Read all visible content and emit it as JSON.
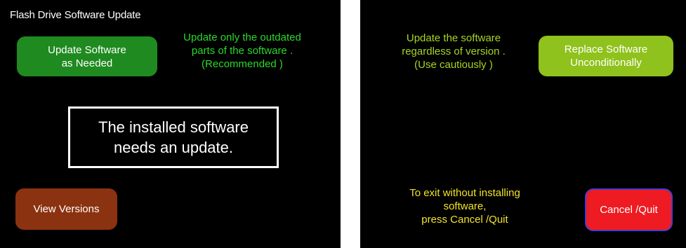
{
  "left_panel": {
    "title": "Flash Drive Software Update",
    "update_button": {
      "line1": "Update Software",
      "line2": "as Needed"
    },
    "update_description": {
      "line1": "Update only the outdated",
      "line2": "parts of the software  .",
      "line3": "(Recommended )"
    },
    "status_message": {
      "line1": "The installed software",
      "line2": "needs an update."
    },
    "view_versions_button": "View Versions"
  },
  "right_panel": {
    "replace_description": {
      "line1": "Update the software",
      "line2": "regardless of version .",
      "line3": "(Use cautiously )"
    },
    "replace_button": {
      "line1": "Replace Software",
      "line2": "Unconditionally"
    },
    "exit_instructions": {
      "line1": "To exit without installing",
      "line2": "software,",
      "line3": "press Cancel /Quit"
    },
    "cancel_button": "Cancel /Quit"
  },
  "colors": {
    "update_button": "#1f8a1f",
    "update_description": "#2bd82b",
    "view_versions_button": "#8b3210",
    "replace_button": "#8fc21c",
    "replace_description": "#a7d424",
    "exit_instructions": "#f2e32a",
    "cancel_button": "#ee1b22",
    "screen_background": "#000000"
  }
}
